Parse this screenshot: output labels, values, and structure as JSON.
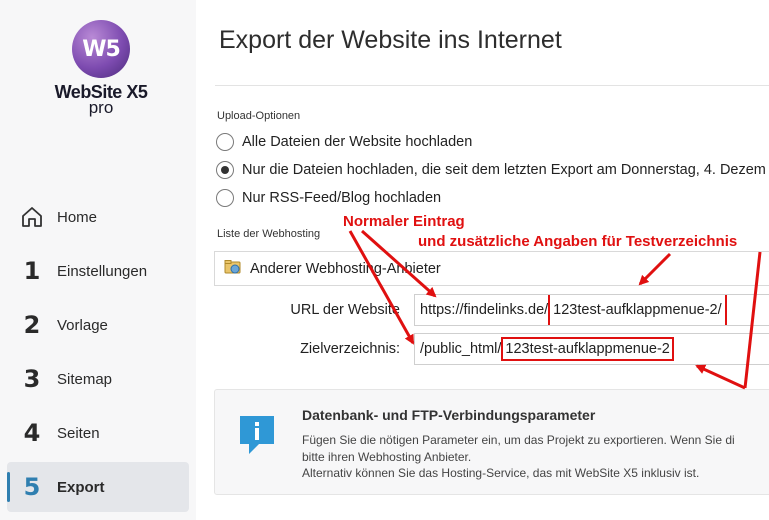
{
  "app": {
    "logo_mark": "W5",
    "logo_name": "WebSite X5",
    "logo_edition": "pro"
  },
  "sidebar": {
    "items": [
      {
        "num": "",
        "label": "Home",
        "icon": "home-icon"
      },
      {
        "num": "1",
        "label": "Einstellungen"
      },
      {
        "num": "2",
        "label": "Vorlage"
      },
      {
        "num": "3",
        "label": "Sitemap"
      },
      {
        "num": "4",
        "label": "Seiten"
      },
      {
        "num": "5",
        "label": "Export",
        "active": true
      }
    ]
  },
  "page": {
    "title": "Export der Website ins Internet"
  },
  "upload": {
    "section_label": "Upload-Optionen",
    "options": [
      {
        "label": "Alle Dateien der Website hochladen",
        "checked": false
      },
      {
        "label": "Nur die Dateien hochladen, die seit dem letzten Export am Donnerstag, 4. Dezem",
        "checked": true
      },
      {
        "label": "Nur RSS-Feed/Blog hochladen",
        "checked": false
      }
    ]
  },
  "webhosting": {
    "section_label": "Liste der Webhosting",
    "provider": "Anderer Webhosting-Anbieter"
  },
  "fields": {
    "url_label": "URL der Website",
    "url_base": "https://findelinks.de/",
    "url_extra": "123test-aufklappmenue-2/",
    "target_label": "Zielverzeichnis:",
    "target_base": "/public_html/",
    "target_extra": "123test-aufklappmenue-2"
  },
  "info": {
    "title": "Datenbank- und FTP-Verbindungsparameter",
    "line1": "Fügen Sie die nötigen Parameter ein, um das Projekt zu exportieren. Wenn Sie di",
    "line2": "bitte ihren Webhosting Anbieter.",
    "line3": "Alternativ können Sie das Hosting-Service, das mit WebSite X5 inklusiv ist."
  },
  "annotations": {
    "normal": "Normaler Eintrag",
    "extra": "und zusätzliche Angaben für Testverzeichnis",
    "color": "#e01010"
  },
  "colors": {
    "accent": "#2f7fb0",
    "info_icon": "#2f98d6"
  }
}
